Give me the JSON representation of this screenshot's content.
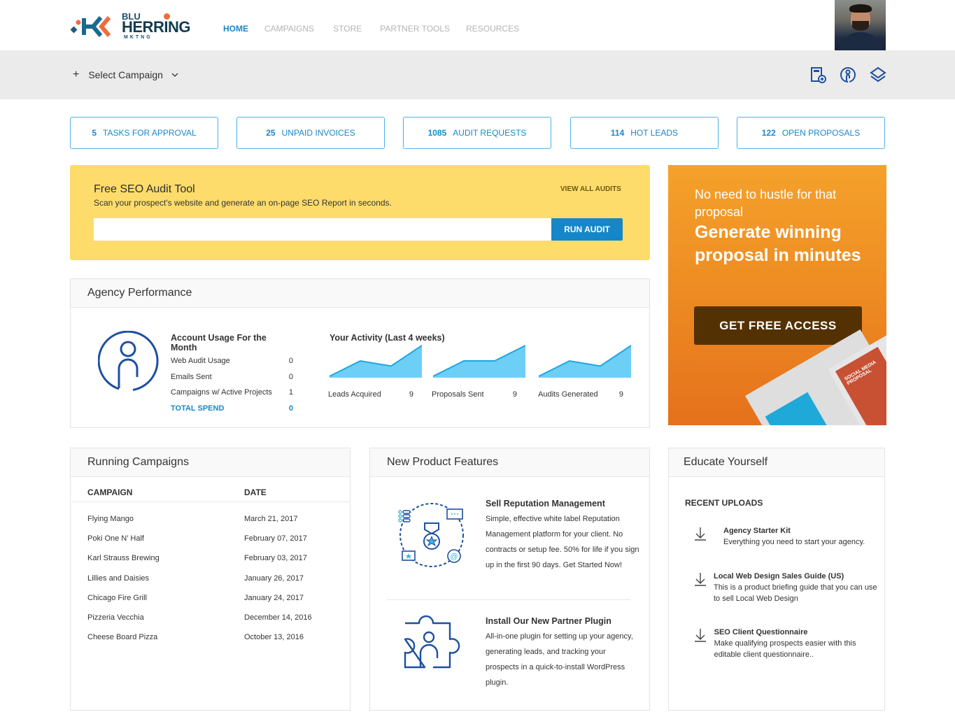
{
  "brand": {
    "line1": "BLU",
    "line2": "HERRING",
    "line3": "MKTNG"
  },
  "nav": [
    {
      "label": "HOME",
      "active": true
    },
    {
      "label": "CAMPAIGNS",
      "active": false
    },
    {
      "label": "STORE",
      "active": false
    },
    {
      "label": "PARTNER TOOLS",
      "active": false
    },
    {
      "label": "RESOURCES",
      "active": false
    }
  ],
  "subbar": {
    "plus": "+",
    "select_campaign": "Select Campaign",
    "icons": [
      "add-document-icon",
      "user-circle-icon",
      "layers-icon"
    ]
  },
  "stats": [
    {
      "count": "5",
      "label": "TASKS FOR APPROVAL"
    },
    {
      "count": "25",
      "label": "UNPAID INVOICES"
    },
    {
      "count": "1085",
      "label": "AUDIT REQUESTS"
    },
    {
      "count": "114",
      "label": "HOT LEADS"
    },
    {
      "count": "122",
      "label": "OPEN PROPOSALS"
    }
  ],
  "seo": {
    "title": "Free SEO Audit Tool",
    "description": "Scan your prospect's website and generate an on-page SEO Report in seconds.",
    "view_all": "VIEW ALL AUDITS",
    "input_value": "",
    "run_label": "RUN AUDIT"
  },
  "promo": {
    "tagline": "No need to hustle for that proposal",
    "headline": "Generate winning proposal in minutes",
    "button": "GET FREE ACCESS",
    "doc_label": "SOCIAL MEDIA PROPOSAL"
  },
  "performance": {
    "title": "Agency Performance",
    "usage_title": "Account Usage For the Month",
    "usage": [
      {
        "label": "Web Audit Usage",
        "value": "0"
      },
      {
        "label": "Emails Sent",
        "value": "0"
      },
      {
        "label": "Campaigns w/ Active Projects",
        "value": "1"
      }
    ],
    "total_label": "TOTAL SPEND",
    "total_value": "0",
    "activity_title": "Your Activity (Last 4 weeks)",
    "activity": [
      {
        "label": "Leads Acquired",
        "value": "9",
        "trend": [
          0,
          4.5,
          3,
          9
        ]
      },
      {
        "label": "Proposals Sent",
        "value": "9",
        "trend": [
          0,
          4.5,
          4.5,
          9
        ]
      },
      {
        "label": "Audits Generated",
        "value": "9",
        "trend": [
          0,
          4.5,
          3,
          9
        ]
      }
    ]
  },
  "campaigns": {
    "title": "Running Campaigns",
    "columns": [
      "CAMPAIGN",
      "DATE"
    ],
    "rows": [
      [
        "Flying Mango",
        "March 21, 2017"
      ],
      [
        "Poki One N' Half",
        "February 07, 2017"
      ],
      [
        "Karl Strauss Brewing",
        "February 03, 2017"
      ],
      [
        "Lillies and Daisies",
        "January 26, 2017"
      ],
      [
        "Chicago Fire Grill",
        "January 24, 2017"
      ],
      [
        "Pizzeria Vecchia",
        "December 14, 2016"
      ],
      [
        "Cheese Board Pizza",
        "October 13, 2016"
      ]
    ]
  },
  "features": {
    "title": "New Product Features",
    "items": [
      {
        "title": "Sell Reputation Management",
        "text": "Simple, effective white label Reputation Management platform for your client. No contracts or setup fee. 50% for life if you sign up in the first 90 days. Get Started Now!",
        "icon": "reputation-medal-icon"
      },
      {
        "title": "Install Our New Partner Plugin",
        "text": "All-in-one plugin for setting up your agency, generating leads, and tracking your prospects in a quick-to-install WordPress plugin.",
        "icon": "puzzle-plugin-icon"
      }
    ]
  },
  "educate": {
    "title": "Educate Yourself",
    "subtitle": "RECENT UPLOADS",
    "uploads": [
      {
        "title": "Agency Starter Kit",
        "text": "Everything you need to start your agency."
      },
      {
        "title": "Local Web Design Sales Guide (US)",
        "text": "This is a product briefing guide that you can use to sell Local Web Design"
      },
      {
        "title": "SEO Client Questionnaire",
        "text": "Make qualifying prospects easier with this editable client questionnaire.."
      }
    ]
  },
  "colors": {
    "accent": "#1a87c9",
    "seo_bg": "#fedc6b",
    "promo_orange": "#ed8b22",
    "promo_button": "#543103",
    "sparkline_fill": "#6dcff6",
    "sparkline_line": "#1fa6e0",
    "icon_blue": "#1e4fa0"
  }
}
